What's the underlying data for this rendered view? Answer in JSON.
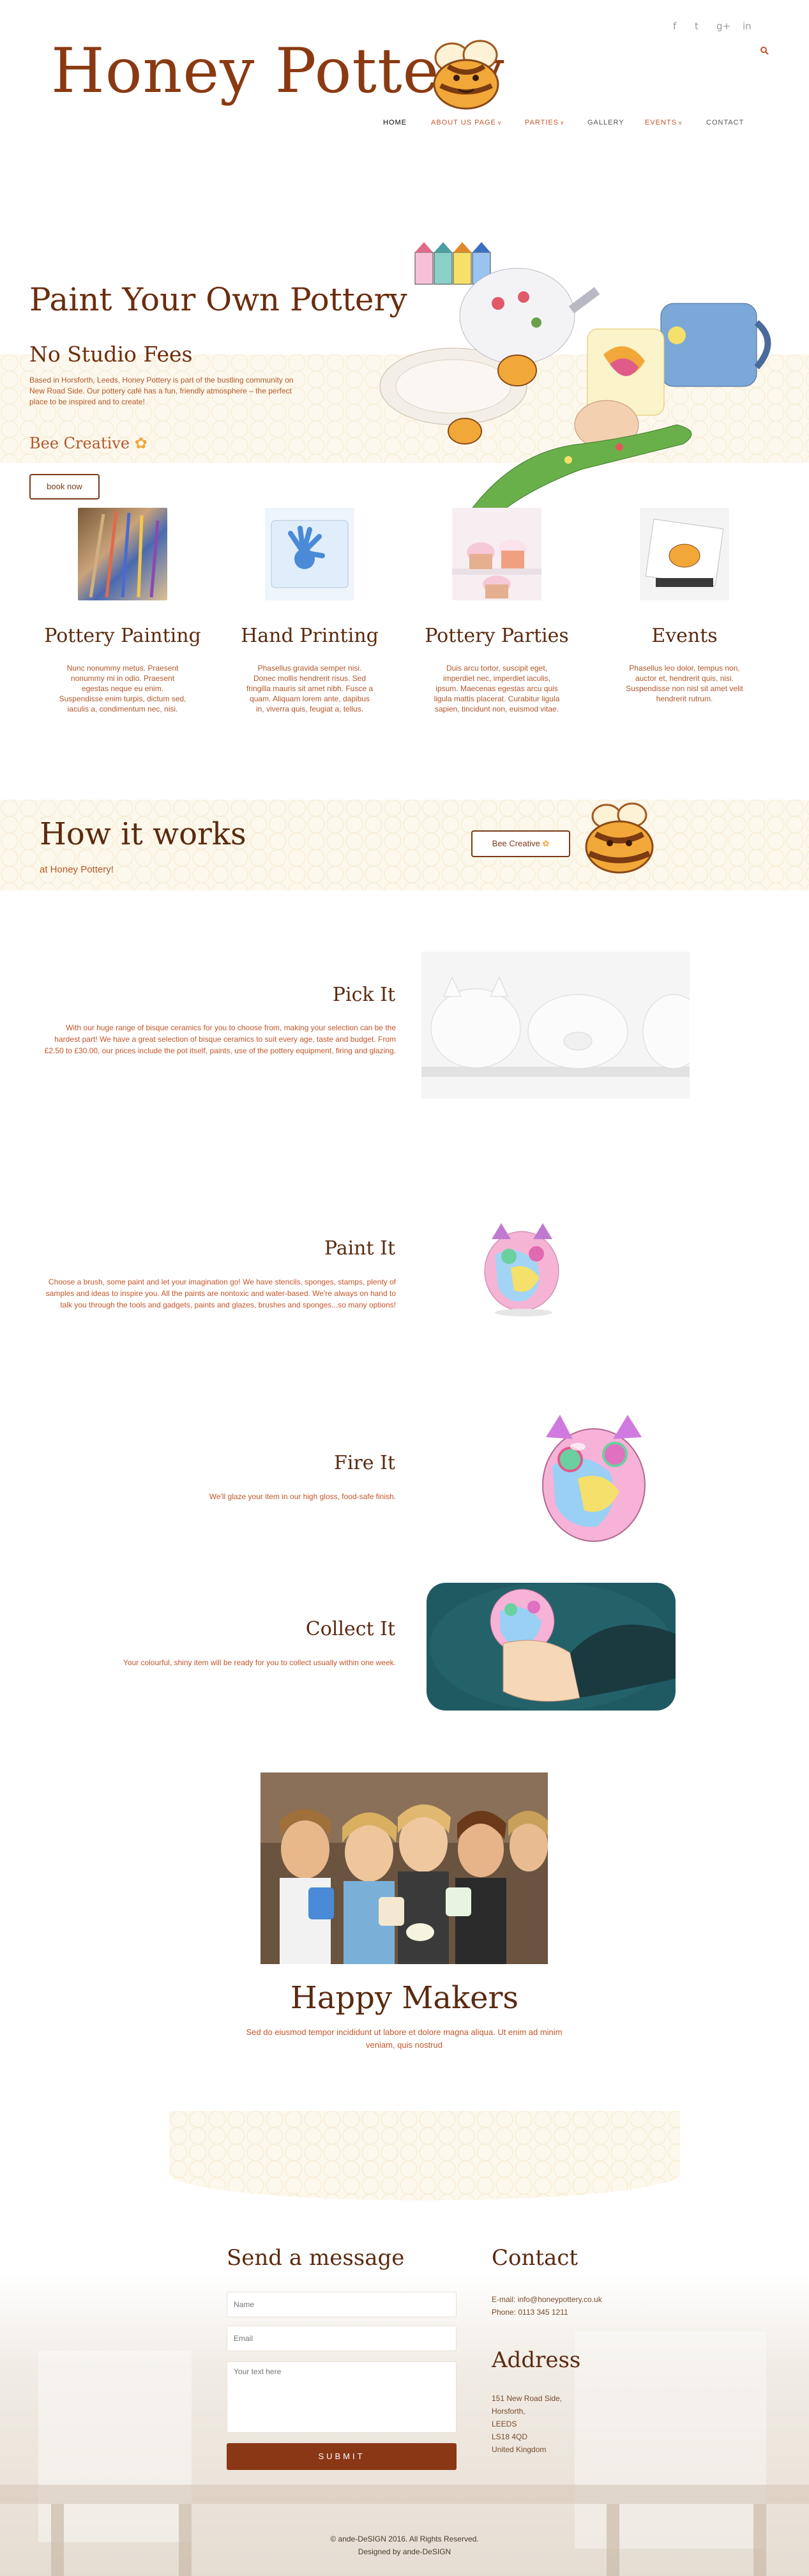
{
  "header": {
    "logo_text": "Honey Pottery",
    "social": [
      "f",
      "t",
      "g+",
      "in"
    ],
    "nav": [
      {
        "label": "HOME",
        "caret": ""
      },
      {
        "label": "ABOUT US PAGE",
        "caret": "v"
      },
      {
        "label": "PARTIES",
        "caret": "v"
      },
      {
        "label": "GALLERY",
        "caret": ""
      },
      {
        "label": "EVENTS",
        "caret": "v"
      },
      {
        "label": "CONTACT",
        "caret": ""
      }
    ]
  },
  "hero": {
    "title": "Paint Your Own Pottery",
    "subtitle": "No Studio Fees",
    "text": "Based in Horsforth, Leeds, Honey Pottery is part of the bustling community on New Road Side. Our pottery café has a fun, friendly atmosphere – the perfect place to be inspired and to create!",
    "creative": "Bee Creative",
    "button": "book now"
  },
  "features": [
    {
      "title": "Pottery Painting",
      "text": "Nunc nonummy metus. Praesent nonummy mi in odio. Praesent egestas neque eu enim. Suspendisse enim turpis, dictum sed, iaculis a, condimentum nec, nisi."
    },
    {
      "title": "Hand Printing",
      "text": "Phasellus gravida semper nisi. Donec mollis hendrerit risus. Sed fringilla mauris sit amet nibh. Fusce a quam. Aliquam lorem ante, dapibus in, viverra quis, feugiat a, tellus."
    },
    {
      "title": "Pottery Parties",
      "text": "Duis arcu tortor, suscipit eget, imperdiet nec, imperdiet iaculis, ipsum. Maecenas egestas arcu quis ligula mattis placerat. Curabitur ligula sapien, tincidunt non, euismod vitae."
    },
    {
      "title": "Events",
      "text": "Phasellus leo dolor, tempus non, auctor et, hendrerit quis, nisi. Suspendisse non nisl sit amet velit hendrerit rutrum."
    }
  ],
  "how": {
    "title": "How it works",
    "subtitle": "at Honey Pottery!",
    "button": "Bee Creative"
  },
  "steps": [
    {
      "title": "Pick It",
      "text": "With our huge range of bisque ceramics for you to choose from, making your selection can be the hardest part! We have a great selection of bisque ceramics to suit every age, taste and budget. From £2.50 to £30.00, our prices include the pot itself, paints, use of the pottery equipment, firing and glazing."
    },
    {
      "title": "Paint It",
      "text": "Choose a brush, some paint and let your imagination go! We have stencils, sponges, stamps, plenty of samples and ideas to inspire you. All the paints are nontoxic and water-based. We're always on hand to talk you through the tools and gadgets, paints and glazes, brushes and sponges...so many options!"
    },
    {
      "title": "Fire It",
      "text": "We'll glaze your item in our high gloss, food-safe finish."
    },
    {
      "title": "Collect It",
      "text": "Your colourful, shiny item will be ready for you to collect usually within one week."
    }
  ],
  "happy": {
    "title": "Happy Makers",
    "text": "Sed do eiusmod tempor incididunt ut labore et dolore magna aliqua. Ut enim ad minim veniam, quis nostrud"
  },
  "contact_form": {
    "title": "Send a message",
    "name_placeholder": "Name",
    "email_placeholder": "Email",
    "text_placeholder": "Your text here",
    "submit": "SUBMIT"
  },
  "contact_info": {
    "title": "Contact",
    "email": "E-mail: info@honeypottery.co.uk",
    "phone": "Phone: 0113 345 1211",
    "address_title": "Address",
    "address_lines": [
      "151 New Road Side,",
      "Horsforth,",
      "LEEDS",
      "LS18 4QD",
      "United Kingdom"
    ]
  },
  "footer": {
    "copyright": "© ande-DeSIGN 2016. All Rights Reserved.",
    "designed": "Designed by ande-DeSIGN"
  },
  "colors": {
    "brand": "#8a3a12",
    "accent": "#c2562a",
    "honey": "#f2a838",
    "submit": "#8a3716"
  }
}
